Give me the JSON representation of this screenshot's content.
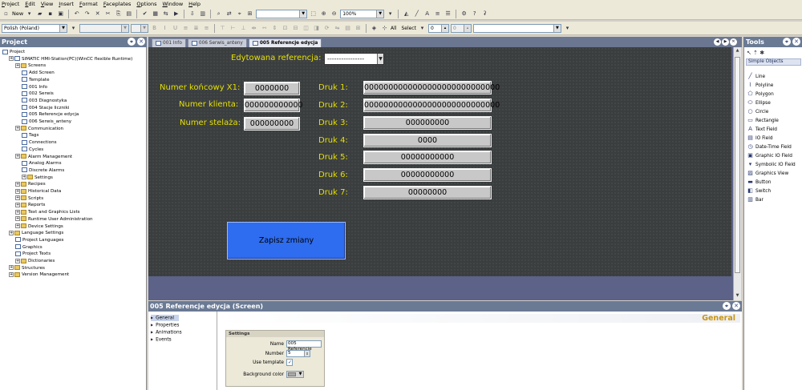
{
  "menu": [
    "Project",
    "Edit",
    "View",
    "Insert",
    "Format",
    "Faceplates",
    "Options",
    "Window",
    "Help"
  ],
  "toolbar1": {
    "new_label": "New",
    "zoom_value": "100%"
  },
  "toolbar2": {
    "language": "Polish (Poland)",
    "all_label": "All",
    "select_label": "Select",
    "spin1": "0",
    "spin2": "0"
  },
  "project": {
    "title": "Project",
    "tree": [
      {
        "label": "Project",
        "indent": 0,
        "icon": "project"
      },
      {
        "label": "SIMATIC HMI-Station(PC)(WinCC flexible Runtime)",
        "indent": 1,
        "icon": "station"
      },
      {
        "label": "Screens",
        "indent": 2,
        "icon": "folder"
      },
      {
        "label": "Add Screen",
        "indent": 3,
        "icon": "screen"
      },
      {
        "label": "Template",
        "indent": 3,
        "icon": "screen"
      },
      {
        "label": "001 Info",
        "indent": 3,
        "icon": "screen"
      },
      {
        "label": "002 Serwis",
        "indent": 3,
        "icon": "screen"
      },
      {
        "label": "003 Diagnostyka",
        "indent": 3,
        "icon": "screen"
      },
      {
        "label": "004 Stacje liczniki",
        "indent": 3,
        "icon": "screen"
      },
      {
        "label": "005 Referencje edycja",
        "indent": 3,
        "icon": "screen"
      },
      {
        "label": "006 Serwis_anteny",
        "indent": 3,
        "icon": "screen"
      },
      {
        "label": "Communication",
        "indent": 2,
        "icon": "folder"
      },
      {
        "label": "Tags",
        "indent": 3,
        "icon": "tags"
      },
      {
        "label": "Connections",
        "indent": 3,
        "icon": "conn"
      },
      {
        "label": "Cycles",
        "indent": 3,
        "icon": "cycle"
      },
      {
        "label": "Alarm Management",
        "indent": 2,
        "icon": "folder"
      },
      {
        "label": "Analog Alarms",
        "indent": 3,
        "icon": "alarm"
      },
      {
        "label": "Discrete Alarms",
        "indent": 3,
        "icon": "alarm"
      },
      {
        "label": "Settings",
        "indent": 3,
        "icon": "folder"
      },
      {
        "label": "Recipes",
        "indent": 2,
        "icon": "folder"
      },
      {
        "label": "Historical Data",
        "indent": 2,
        "icon": "folder"
      },
      {
        "label": "Scripts",
        "indent": 2,
        "icon": "folder"
      },
      {
        "label": "Reports",
        "indent": 2,
        "icon": "folder"
      },
      {
        "label": "Text and Graphics Lists",
        "indent": 2,
        "icon": "folder"
      },
      {
        "label": "Runtime User Administration",
        "indent": 2,
        "icon": "folder"
      },
      {
        "label": "Device Settings",
        "indent": 2,
        "icon": "folder"
      },
      {
        "label": "Language Settings",
        "indent": 1,
        "icon": "folder"
      },
      {
        "label": "Project Languages",
        "indent": 2,
        "icon": "lang"
      },
      {
        "label": "Graphics",
        "indent": 2,
        "icon": "graphic"
      },
      {
        "label": "Project Texts",
        "indent": 2,
        "icon": "text"
      },
      {
        "label": "Dictionaries",
        "indent": 2,
        "icon": "folder"
      },
      {
        "label": "Structures",
        "indent": 1,
        "icon": "folder"
      },
      {
        "label": "Version Management",
        "indent": 1,
        "icon": "folder"
      }
    ]
  },
  "tabs": [
    {
      "label": "001 Info",
      "active": false
    },
    {
      "label": "006 Serwis_anteny",
      "active": false
    },
    {
      "label": "005 Referencje edycja",
      "active": true
    }
  ],
  "screen": {
    "ref_label": "Edytowana referencja:",
    "ref_value": "----------------",
    "left_fields": [
      {
        "label": "Numer końcowy X1:",
        "value": "0000000"
      },
      {
        "label": "Numer klienta:",
        "value": "000000000000"
      },
      {
        "label": "Numer stelaża:",
        "value": "000000000"
      }
    ],
    "druk": [
      {
        "label": "Druk 1:",
        "value": "0000000000000000000000000000"
      },
      {
        "label": "Druk 2:",
        "value": "0000000000000000000000000000"
      },
      {
        "label": "Druk 3:",
        "value": "000000000"
      },
      {
        "label": "Druk 4:",
        "value": "0000"
      },
      {
        "label": "Druk 5:",
        "value": "00000000000"
      },
      {
        "label": "Druk 6:",
        "value": "00000000000"
      },
      {
        "label": "Druk 7:",
        "value": "00000000"
      }
    ],
    "save_button": "Zapisz zmiany"
  },
  "tools": {
    "title": "Tools",
    "category": "Simple Objects",
    "items": [
      {
        "label": "Line",
        "icon": "line-icon",
        "glyph": "╱"
      },
      {
        "label": "Polyline",
        "icon": "polyline-icon",
        "glyph": "⌇"
      },
      {
        "label": "Polygon",
        "icon": "polygon-icon",
        "glyph": "⬠"
      },
      {
        "label": "Ellipse",
        "icon": "ellipse-icon",
        "glyph": "⬭"
      },
      {
        "label": "Circle",
        "icon": "circle-icon",
        "glyph": "○"
      },
      {
        "label": "Rectangle",
        "icon": "rectangle-icon",
        "glyph": "▭"
      },
      {
        "label": "Text Field",
        "icon": "text-field-icon",
        "glyph": "A"
      },
      {
        "label": "IO Field",
        "icon": "io-field-icon",
        "glyph": "▤"
      },
      {
        "label": "Date-Time Field",
        "icon": "date-time-icon",
        "glyph": "◷"
      },
      {
        "label": "Graphic IO Field",
        "icon": "graphic-io-icon",
        "glyph": "▣"
      },
      {
        "label": "Symbolic IO Field",
        "icon": "symbolic-io-icon",
        "glyph": "▾"
      },
      {
        "label": "Graphics View",
        "icon": "graphics-view-icon",
        "glyph": "▨"
      },
      {
        "label": "Button",
        "icon": "button-icon",
        "glyph": "▬"
      },
      {
        "label": "Switch",
        "icon": "switch-icon",
        "glyph": "◧"
      },
      {
        "label": "Bar",
        "icon": "bar-icon",
        "glyph": "▥"
      }
    ]
  },
  "properties": {
    "title": "005 Referencje edycja (Screen)",
    "nav": [
      "General",
      "Properties",
      "Animations",
      "Events"
    ],
    "section_title": "General",
    "settings_title": "Settings",
    "name_label": "Name",
    "name_value": "005 Referencje",
    "number_label": "Number",
    "number_value": "5",
    "use_template_label": "Use template",
    "bg_color_label": "Background color"
  }
}
